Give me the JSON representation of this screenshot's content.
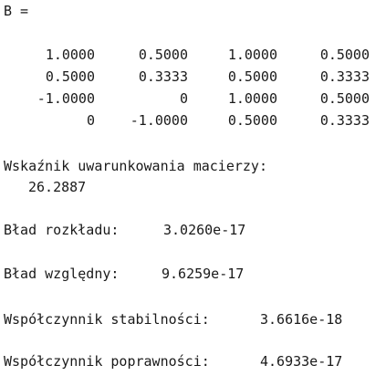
{
  "matrix": {
    "label": "B =",
    "rows": [
      [
        "1.0000",
        "0.5000",
        "1.0000",
        "0.5000"
      ],
      [
        "0.5000",
        "0.3333",
        "0.5000",
        "0.3333"
      ],
      [
        "-1.0000",
        "0",
        "1.0000",
        "0.5000"
      ],
      [
        "0",
        "-1.0000",
        "0.5000",
        "0.3333"
      ]
    ]
  },
  "condition": {
    "label": "Wskaźnik uwarunkowania macierzy:",
    "value": "26.2887"
  },
  "decomp_error": {
    "label": "Bład rozkładu:",
    "value": "3.0260e-17"
  },
  "relative_error": {
    "label": "Bład względny:",
    "value": "9.6259e-17"
  },
  "stability": {
    "label": "Współczynnik stabilności:",
    "value": "3.6616e-18"
  },
  "correctness": {
    "label": "Współczynnik poprawności:",
    "value": "4.6933e-17"
  }
}
